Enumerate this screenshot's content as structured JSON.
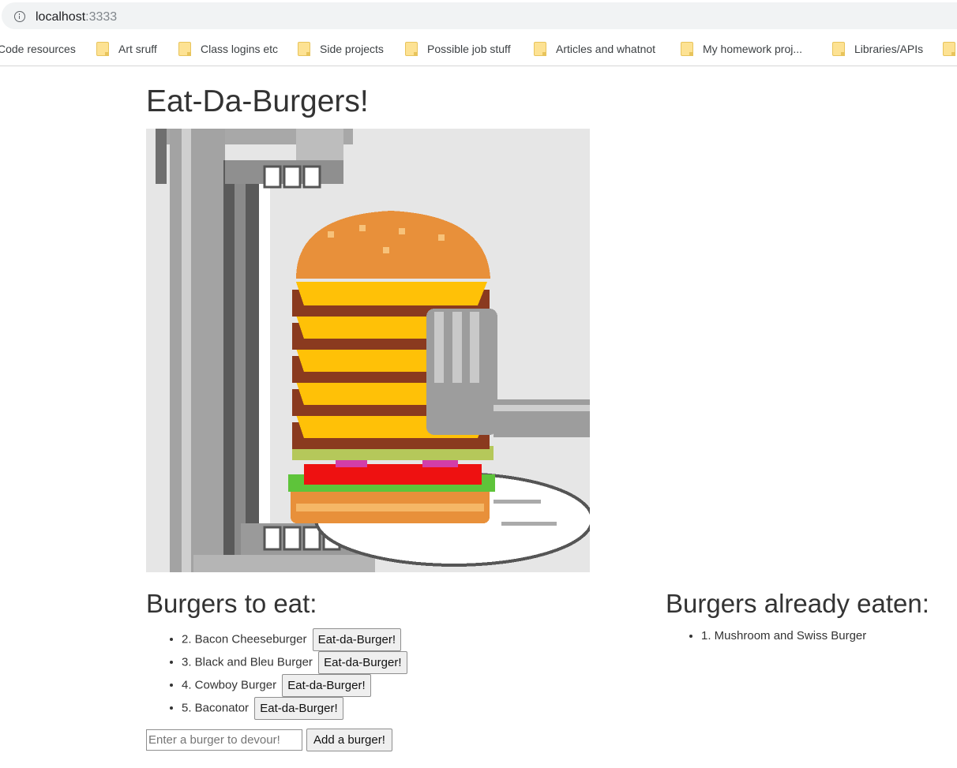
{
  "browser": {
    "url_host": "localhost",
    "url_port": ":3333",
    "bookmarks": [
      {
        "label": "Code resources"
      },
      {
        "label": "Art sruff"
      },
      {
        "label": "Class logins etc"
      },
      {
        "label": "Side projects"
      },
      {
        "label": "Possible job stuff"
      },
      {
        "label": "Articles and whatnot"
      },
      {
        "label": "My homework proj..."
      },
      {
        "label": "Libraries/APIs"
      }
    ]
  },
  "page": {
    "title": "Eat-Da-Burgers!"
  },
  "to_eat": {
    "heading": "Burgers to eat:",
    "items": [
      {
        "label": "2. Bacon Cheeseburger",
        "button": "Eat-da-Burger!"
      },
      {
        "label": "3. Black and Bleu Burger",
        "button": "Eat-da-Burger!"
      },
      {
        "label": "4. Cowboy Burger",
        "button": "Eat-da-Burger!"
      },
      {
        "label": "5. Baconator",
        "button": "Eat-da-Burger!"
      }
    ]
  },
  "eaten": {
    "heading": "Burgers already eaten:",
    "items": [
      {
        "label": "1. Mushroom and Swiss Burger"
      }
    ]
  },
  "form": {
    "placeholder": "Enter a burger to devour!",
    "value": "",
    "submit_label": "Add a burger!"
  }
}
